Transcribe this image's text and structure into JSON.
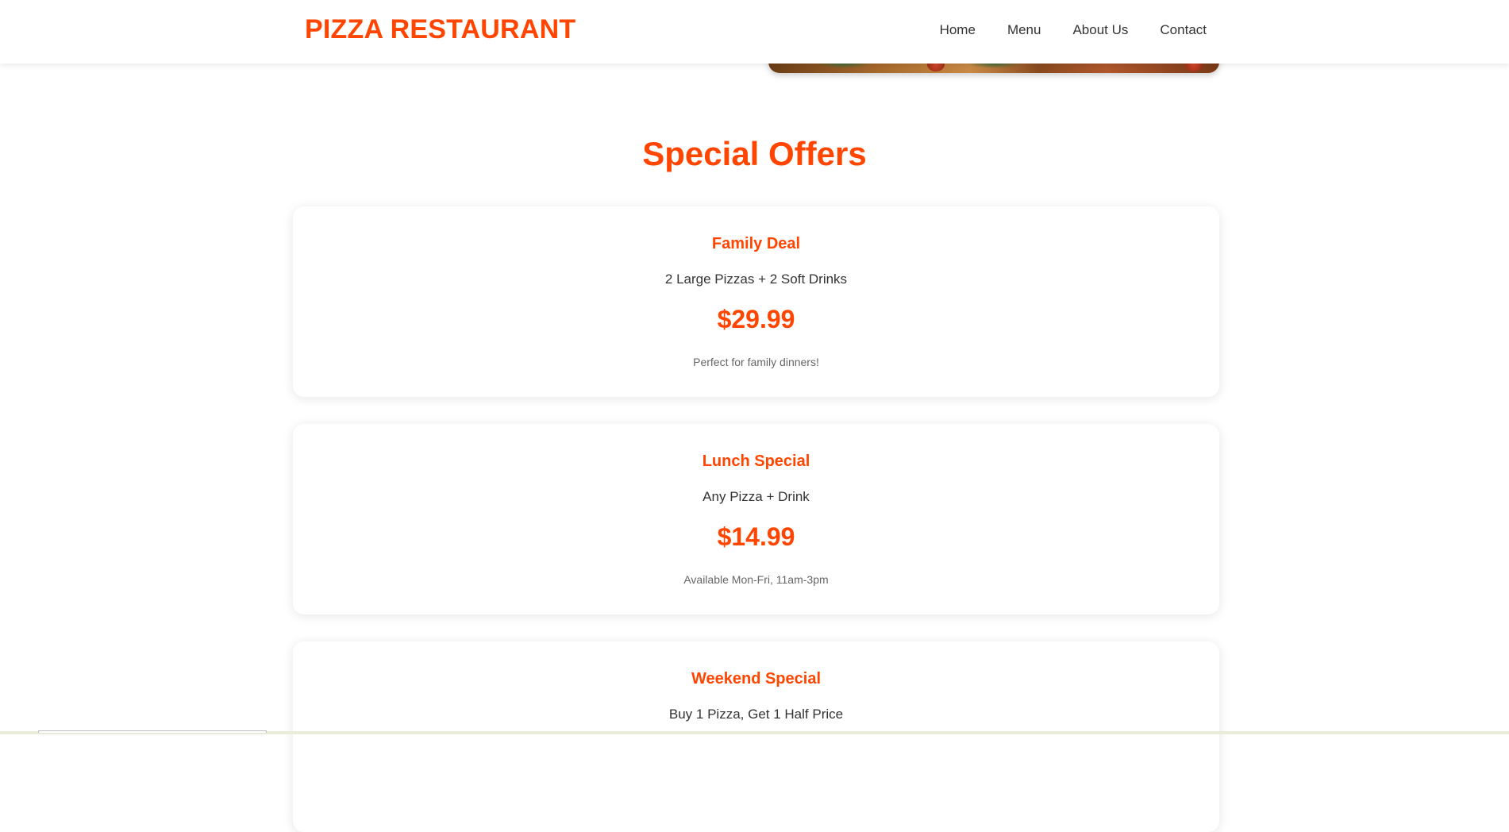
{
  "header": {
    "logo": "PIZZA RESTAURANT",
    "nav": [
      {
        "label": "Home"
      },
      {
        "label": "Menu"
      },
      {
        "label": "About Us"
      },
      {
        "label": "Contact"
      }
    ]
  },
  "hero": {
    "image": "pizza-photo"
  },
  "offers": {
    "title": "Special Offers",
    "items": [
      {
        "name": "Family Deal",
        "description": "2 Large Pizzas + 2 Soft Drinks",
        "price": "$29.99",
        "note": "Perfect for family dinners!"
      },
      {
        "name": "Lunch Special",
        "description": "Any Pizza + Drink",
        "price": "$14.99",
        "note": "Available Mon-Fri, 11am-3pm"
      },
      {
        "name": "Weekend Special",
        "description": "Buy 1 Pizza, Get 1 Half Price"
      }
    ]
  },
  "colors": {
    "accent": "#ff4500",
    "text": "#333333",
    "muted": "#666666",
    "background": "#ffffff"
  }
}
